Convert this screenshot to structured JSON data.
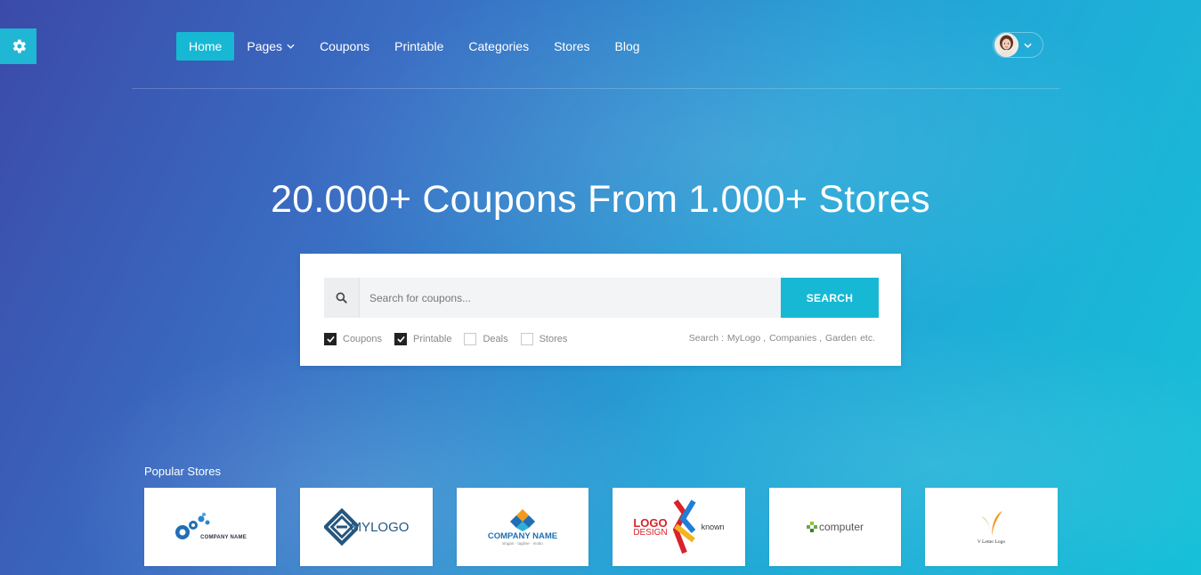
{
  "nav": {
    "items": [
      {
        "label": "Home",
        "active": true
      },
      {
        "label": "Pages",
        "has_dropdown": true
      },
      {
        "label": "Coupons"
      },
      {
        "label": "Printable"
      },
      {
        "label": "Categories"
      },
      {
        "label": "Stores"
      },
      {
        "label": "Blog"
      }
    ]
  },
  "hero": {
    "title": "20.000+ Coupons From 1.000+ Stores"
  },
  "search": {
    "placeholder": "Search for coupons...",
    "button_label": "SEARCH",
    "filters": [
      {
        "label": "Coupons",
        "checked": true
      },
      {
        "label": "Printable",
        "checked": true
      },
      {
        "label": "Deals",
        "checked": false
      },
      {
        "label": "Stores",
        "checked": false
      }
    ],
    "hint_prefix": "Search :",
    "hint_links": [
      "MyLogo ,",
      "Companies ,",
      "Garden",
      "etc."
    ]
  },
  "popular_stores": {
    "title": "Popular Stores",
    "stores": [
      {
        "logo_text": "COMPANY NAME",
        "icon": "bubbles-logo-icon"
      },
      {
        "logo_text": "MYLOGO",
        "icon": "diamond-maze-logo-icon"
      },
      {
        "logo_text": "COMPANY NAME",
        "sub_text": "slogan · tagline · motto",
        "icon": "diamond-tiles-logo-icon"
      },
      {
        "logo_text_a": "LOGO",
        "logo_text_b": "DESIGN",
        "logo_text_c": "known",
        "icon": "ribbon-k-logo-icon"
      },
      {
        "logo_text": "computer",
        "icon": "pixel-cubes-logo-icon"
      },
      {
        "logo_text": "V Letter Logo",
        "icon": "v-letter-logo-icon"
      }
    ]
  },
  "colors": {
    "accent": "#17b8d4",
    "gradient_start": "#3b4aa8",
    "gradient_end": "#16c0d8"
  }
}
